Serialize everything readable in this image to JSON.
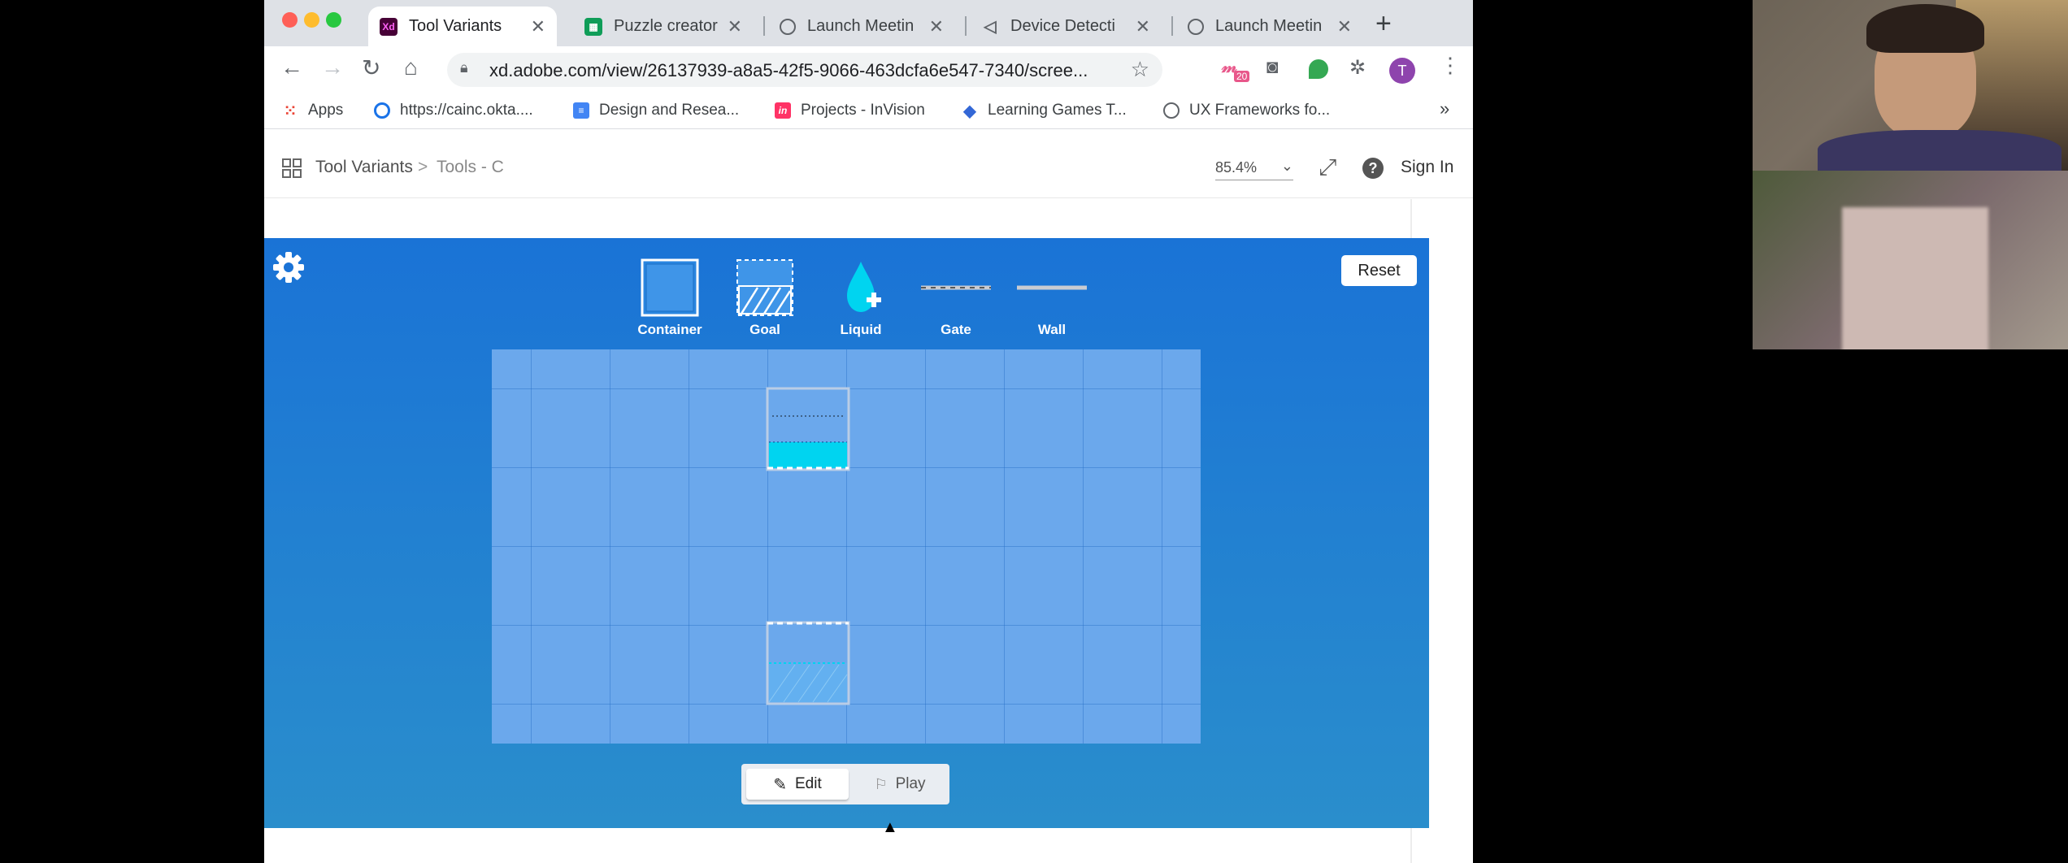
{
  "browser": {
    "tabs": [
      {
        "label": "Tool Variants",
        "icon": "adobe-xd-icon",
        "favicon_text": "Xd",
        "color": "#470137"
      },
      {
        "label": "Puzzle creator",
        "icon": "google-sheets-icon",
        "color": "#0f9d58"
      },
      {
        "label": "Launch Meetin",
        "icon": "globe-icon",
        "color": "#5f6368"
      },
      {
        "label": "Device Detecti",
        "icon": "unity-icon",
        "color": "#5f6368"
      },
      {
        "label": "Launch Meetin",
        "icon": "globe-icon",
        "color": "#5f6368"
      }
    ],
    "url": "xd.adobe.com/view/26137939-a8a5-42f5-9066-463dcfa6e547-7340/scree...",
    "profile_initial": "T",
    "extension_badge": "20",
    "bookmarks": [
      {
        "label": "Apps",
        "icon": "apps-grid-icon"
      },
      {
        "label": "https://cainc.okta....",
        "icon": "okta-icon"
      },
      {
        "label": "Design and Resea...",
        "icon": "google-docs-icon"
      },
      {
        "label": "Projects - InVision",
        "icon": "invision-icon",
        "favicon_text": "in"
      },
      {
        "label": "Learning Games T...",
        "icon": "diamond-icon"
      },
      {
        "label": "UX Frameworks fo...",
        "icon": "globe-icon"
      }
    ],
    "more_bookmarks": "»"
  },
  "xd": {
    "breadcrumb_root": "Tool Variants",
    "breadcrumb_sep": ">",
    "breadcrumb_current": "Tools - C",
    "zoom": "85.4%",
    "sign_in": "Sign In"
  },
  "game": {
    "reset_label": "Reset",
    "tools": [
      {
        "label": "Container",
        "icon": "container-icon"
      },
      {
        "label": "Goal",
        "icon": "goal-icon"
      },
      {
        "label": "Liquid",
        "icon": "liquid-drop-icon"
      },
      {
        "label": "Gate",
        "icon": "gate-icon"
      },
      {
        "label": "Wall",
        "icon": "wall-icon"
      }
    ],
    "edit_label": "Edit",
    "play_label": "Play",
    "colors": {
      "liquid": "#00d4f0",
      "grid": "#6ba8ec",
      "board_top": "#1a73d6",
      "board_bottom": "#2a8ecc"
    }
  }
}
